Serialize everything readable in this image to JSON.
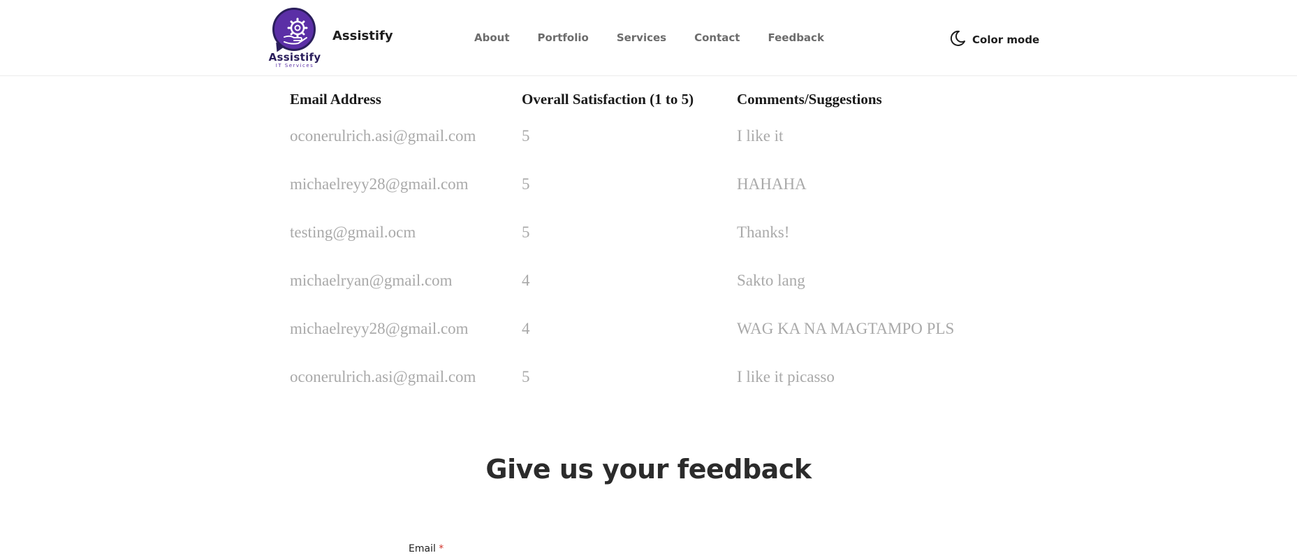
{
  "header": {
    "logo_text": "Assistify",
    "logo_subtext": "IT Services",
    "brand_name": "Assistify",
    "nav": [
      {
        "label": "About"
      },
      {
        "label": "Portfolio"
      },
      {
        "label": "Services"
      },
      {
        "label": "Contact"
      },
      {
        "label": "Feedback"
      }
    ],
    "color_mode_label": "Color mode",
    "colors": {
      "brand_purple": "#5b2fa6",
      "brand_dark": "#2a1e5c"
    }
  },
  "table": {
    "headers": [
      "Email Address",
      "Overall Satisfaction (1 to 5)",
      "Comments/Suggestions"
    ],
    "rows": [
      [
        "oconerulrich.asi@gmail.com",
        "5",
        "I like it"
      ],
      [
        "michaelreyy28@gmail.com",
        "5",
        "HAHAHA"
      ],
      [
        "testing@gmail.ocm",
        "5",
        "Thanks!"
      ],
      [
        "michaelryan@gmail.com",
        "4",
        "Sakto lang"
      ],
      [
        "michaelreyy28@gmail.com",
        "4",
        "WAG KA NA MAGTAMPO PLS"
      ],
      [
        "oconerulrich.asi@gmail.com",
        "5",
        "I like it picasso"
      ]
    ]
  },
  "form": {
    "title": "Give us your feedback",
    "email_label": "Email",
    "required_marker": "*"
  }
}
